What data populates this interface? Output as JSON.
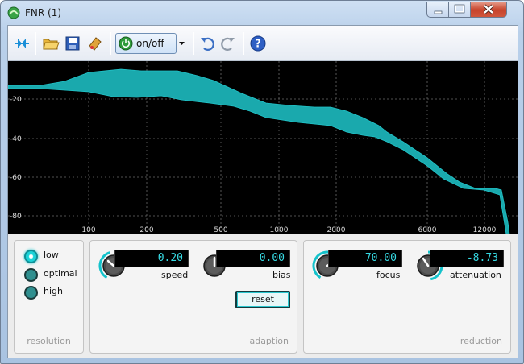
{
  "window": {
    "title": "FNR (1)"
  },
  "toolbar": {
    "onoff_label": "on/off"
  },
  "graph": {
    "y_ticks": [
      "-20",
      "-40",
      "-60",
      "-80"
    ],
    "x_ticks": [
      "100",
      "200",
      "500",
      "1000",
      "2000",
      "6000",
      "12000"
    ],
    "trace_color": "#1fb5b5"
  },
  "resolution": {
    "label": "resolution",
    "options": [
      "low",
      "optimal",
      "high"
    ],
    "selected": "low"
  },
  "adaption": {
    "label": "adaption",
    "speed": {
      "value": "0.20",
      "label": "speed"
    },
    "bias": {
      "value": "0.00",
      "label": "bias"
    },
    "reset_label": "reset"
  },
  "reduction": {
    "label": "reduction",
    "focus": {
      "value": "70.00",
      "label": "focus"
    },
    "attenuation": {
      "value": "-8.73",
      "label": "attenuation"
    }
  },
  "colors": {
    "accent": "#1fc9d2",
    "display_text": "#36d9e2"
  }
}
